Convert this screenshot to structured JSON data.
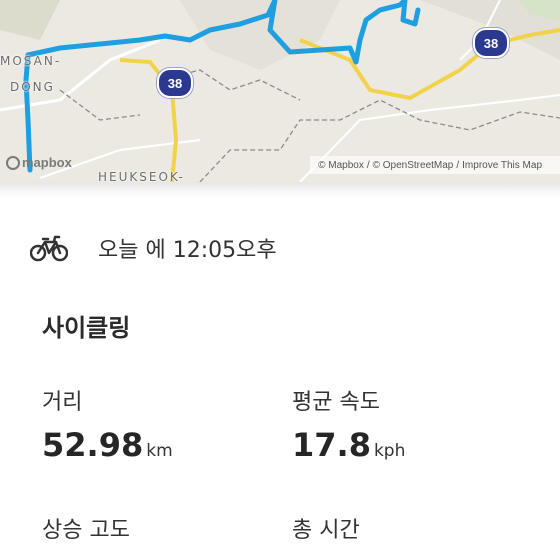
{
  "map": {
    "places": [
      "MOSAN-",
      "DONG",
      "HEUKSEOK-"
    ],
    "route_shield": "38",
    "logo_text": "mapbox",
    "attribution": [
      "© Mapbox",
      "/",
      "© OpenStreetMap",
      "/",
      "Improve This Map"
    ],
    "route_color": "#1e9fe0",
    "road_color": "#f3d24b"
  },
  "activity": {
    "icon": "bicycle-icon",
    "time": "오늘 에 12:05오후",
    "type": "사이클링"
  },
  "stats": {
    "distance": {
      "label": "거리",
      "value": "52.98",
      "unit": "km"
    },
    "avg_speed": {
      "label": "평균 속도",
      "value": "17.8",
      "unit": "kph"
    },
    "elevation": {
      "label": "상승 고도"
    },
    "total_time": {
      "label": "총 시간"
    }
  }
}
